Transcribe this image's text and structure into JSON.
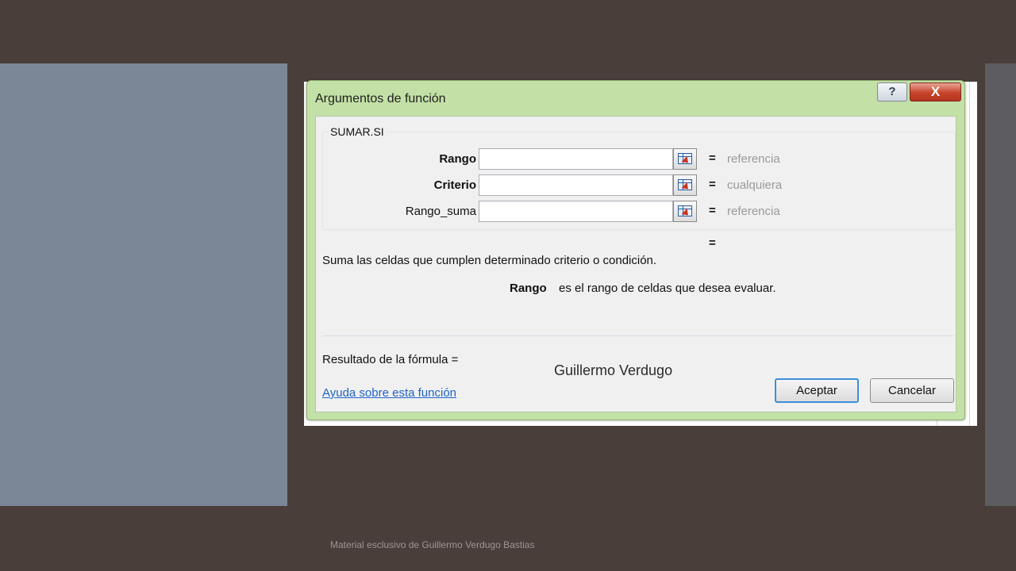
{
  "dialog": {
    "title": "Argumentos de función",
    "help_button": "?",
    "close_button": "X",
    "function_name": "SUMAR.SI",
    "args": [
      {
        "label": "Rango",
        "bold": true,
        "value": "",
        "eq": "=",
        "result": "referencia"
      },
      {
        "label": "Criterio",
        "bold": true,
        "value": "",
        "eq": "=",
        "result": "cualquiera"
      },
      {
        "label": "Rango_suma",
        "bold": false,
        "value": "",
        "eq": "=",
        "result": "referencia"
      }
    ],
    "lone_eq": "=",
    "description": "Suma las celdas que cumplen determinado criterio o condición.",
    "arg_help_name": "Rango",
    "arg_help_text": "es el rango de celdas que desea evaluar.",
    "result_label": "Resultado de la fórmula =",
    "watermark": "Guillermo Verdugo",
    "help_link": "Ayuda sobre esta función",
    "ok_button": "Aceptar",
    "cancel_button": "Cancelar"
  },
  "footer": "Material esclusivo de Guillermo Verdugo Bastias",
  "colors": {
    "background": "#4a3e3a",
    "left_panel": "#7b8797",
    "dialog_frame": "#c3e0a6",
    "link": "#1f64c8"
  }
}
